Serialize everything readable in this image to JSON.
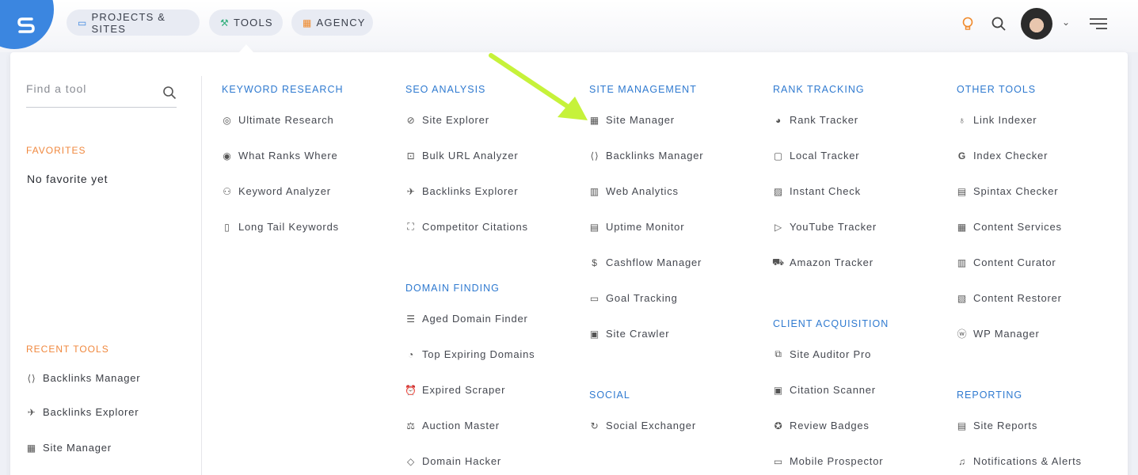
{
  "nav": {
    "projects_label": "PROJECTS & SITES",
    "tools_label": "TOOLS",
    "agency_label": "AGENCY"
  },
  "sidebar": {
    "search_placeholder": "Find a tool",
    "favorites_title": "FAVORITES",
    "favorites_empty": "No favorite yet",
    "recent_title": "RECENT TOOLS",
    "recent": [
      {
        "label": "Backlinks Manager",
        "icon": "code-file-icon"
      },
      {
        "label": "Backlinks Explorer",
        "icon": "link-explorer-icon"
      },
      {
        "label": "Site Manager",
        "icon": "grid-icon"
      }
    ]
  },
  "sections": {
    "keyword_research": {
      "title": "KEYWORD RESEARCH",
      "tools": [
        {
          "label": "Ultimate Research",
          "icon": "target-icon"
        },
        {
          "label": "What Ranks Where",
          "icon": "eye-icon"
        },
        {
          "label": "Keyword Analyzer",
          "icon": "people-icon"
        },
        {
          "label": "Long Tail Keywords",
          "icon": "file-icon"
        }
      ]
    },
    "seo_analysis": {
      "title": "SEO ANALYSIS",
      "tools": [
        {
          "label": "Site Explorer",
          "icon": "compass-icon"
        },
        {
          "label": "Bulk URL Analyzer",
          "icon": "robot-icon"
        },
        {
          "label": "Backlinks Explorer",
          "icon": "link-explorer-icon"
        },
        {
          "label": "Competitor Citations",
          "icon": "users-frame-icon"
        }
      ]
    },
    "domain_finding": {
      "title": "DOMAIN FINDING",
      "tools": [
        {
          "label": "Aged Domain Finder",
          "icon": "list-icon"
        },
        {
          "label": "Top Expiring Domains",
          "icon": "timer-icon"
        },
        {
          "label": "Expired Scraper",
          "icon": "alarm-icon"
        },
        {
          "label": "Auction Master",
          "icon": "gavel-icon"
        },
        {
          "label": "Domain Hacker",
          "icon": "diamond-icon"
        }
      ]
    },
    "site_management": {
      "title": "SITE MANAGEMENT",
      "tools": [
        {
          "label": "Site Manager",
          "icon": "grid-icon"
        },
        {
          "label": "Backlinks Manager",
          "icon": "code-file-icon"
        },
        {
          "label": "Web Analytics",
          "icon": "bar-chart-icon"
        },
        {
          "label": "Uptime Monitor",
          "icon": "monitor-icon"
        },
        {
          "label": "Cashflow Manager",
          "icon": "dollar-icon"
        },
        {
          "label": "Goal Tracking",
          "icon": "goal-icon"
        },
        {
          "label": "Site Crawler",
          "icon": "crawler-icon"
        }
      ]
    },
    "social": {
      "title": "SOCIAL",
      "tools": [
        {
          "label": "Social Exchanger",
          "icon": "refresh-icon"
        }
      ]
    },
    "rank_tracking": {
      "title": "RANK TRACKING",
      "tools": [
        {
          "label": "Rank Tracker",
          "icon": "rank-icon"
        },
        {
          "label": "Local Tracker",
          "icon": "local-icon"
        },
        {
          "label": "Instant Check",
          "icon": "instant-icon"
        },
        {
          "label": "YouTube Tracker",
          "icon": "youtube-icon"
        },
        {
          "label": "Amazon Tracker",
          "icon": "cart-icon"
        }
      ]
    },
    "client_acquisition": {
      "title": "CLIENT ACQUISITION",
      "tools": [
        {
          "label": "Site Auditor Pro",
          "icon": "puzzle-icon"
        },
        {
          "label": "Citation Scanner",
          "icon": "scanner-icon"
        },
        {
          "label": "Review Badges",
          "icon": "badge-icon"
        },
        {
          "label": "Mobile Prospector",
          "icon": "mobile-icon"
        }
      ]
    },
    "other_tools": {
      "title": "OTHER TOOLS",
      "tools": [
        {
          "label": "Link Indexer",
          "icon": "indexer-icon"
        },
        {
          "label": "Index Checker",
          "icon": "google-icon"
        },
        {
          "label": "Spintax Checker",
          "icon": "spintax-icon"
        },
        {
          "label": "Content Services",
          "icon": "calendar-icon"
        },
        {
          "label": "Content Curator",
          "icon": "curator-icon"
        },
        {
          "label": "Content Restorer",
          "icon": "restore-icon"
        },
        {
          "label": "WP Manager",
          "icon": "wordpress-icon"
        }
      ]
    },
    "reporting": {
      "title": "REPORTING",
      "tools": [
        {
          "label": "Site Reports",
          "icon": "report-icon"
        },
        {
          "label": "Notifications & Alerts",
          "icon": "bell-icon"
        }
      ]
    }
  },
  "colors": {
    "brand": "#3b86e0",
    "section_title": "#2f7ad0",
    "sidebar_title": "#f0883e",
    "arrow": "#c6f23a"
  }
}
